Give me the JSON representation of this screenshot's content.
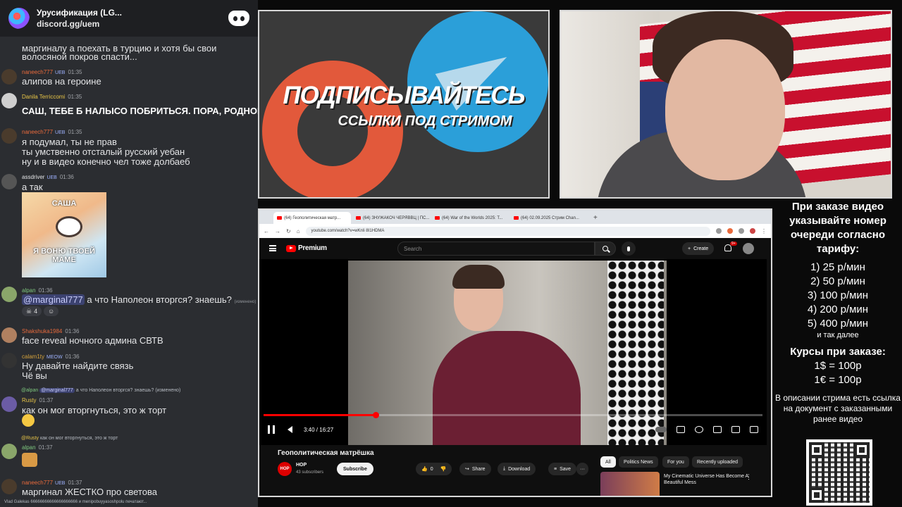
{
  "discord": {
    "server_name": "Урусификация (LG...",
    "invite": "discord.gg/uem",
    "messages": [
      {
        "lines": [
          "маргиналу а поехать в турцию и хотя бы свои",
          "волосяной покров спасти..."
        ]
      },
      {
        "author": "naneech777",
        "author_color": "#e96a3c",
        "badge": "UEB",
        "time": "01:35",
        "lines": [
          "алипов на героине"
        ]
      },
      {
        "author": "Danila Terriccomi",
        "author_color": "#e8c547",
        "time": "01:35",
        "lines": [
          "САШ, ТЕБЕ Б НАЛЫСО ПОБРИТЬСЯ. ПОРА, РОДНОЙ!"
        ]
      },
      {
        "author": "naneech777",
        "author_color": "#e96a3c",
        "badge": "UEB",
        "time": "01:35",
        "lines": [
          "я подумал, ты не прав",
          "ты умственно отсталый русский уебан",
          "ну и в видео конечно чел тоже долбаеб"
        ]
      },
      {
        "author": "assdriver",
        "author_color": "#e3e4e6",
        "badge": "UEB",
        "time": "01:36",
        "lines": [
          "а так"
        ],
        "sticker": {
          "top": "САША",
          "bottom": "Я ВОНЮ ТВОЕЙ МАМЕ"
        }
      },
      {
        "author": "alpan",
        "author_color": "#7fc97f",
        "time": "01:36",
        "mention": "@marginal777",
        "text_after": " а что Наполеон вторгся? знаешь?",
        "edited": "(изменено)",
        "reaction_count": "4"
      },
      {
        "author": "Shakshuka1984",
        "author_color": "#e96a3c",
        "time": "01:36",
        "lines": [
          "face reveal ночного админа СВТВ"
        ]
      },
      {
        "author": "calam1ty",
        "author_color": "#d4a23c",
        "badge": "MEOW",
        "time": "01:36",
        "lines": [
          "Ну давайте найдите связь",
          "Чё вы"
        ]
      },
      {
        "reply_author": "@alpan",
        "reply_mention": "@marginal777",
        "reply_text": " а что Наполеон вторгся? знаешь?",
        "reply_edited": "(изменено)",
        "author": "Rusty",
        "author_color": "#e8c547",
        "time": "01:37",
        "lines": [
          "как он мог вторгнуться, это ж торт"
        ]
      },
      {
        "reply_author": "@Rusty",
        "reply_text": " как он мог вторгнуться, это ж торт",
        "author": "alpan",
        "author_color": "#7fc97f",
        "time": "01:37"
      },
      {
        "author": "naneech777",
        "author_color": "#e96a3c",
        "badge": "UEB",
        "time": "01:37",
        "lines": [
          "маргинал ЖЕСТКО про светова"
        ]
      }
    ],
    "typing": "Vlad Galekas 66666666666666666666 и menipobuyyasoshpolu печатают..."
  },
  "promo": {
    "headline": "ПОДПИСЫВАЙТЕСЬ",
    "subline": "ССЫЛКИ ПОД СТРИМОМ"
  },
  "browser": {
    "tabs": [
      {
        "title": "(64) Геополитическая матр...",
        "active": true
      },
      {
        "title": "(64) ЗНУЖАКОЧ ЧЕРЯВВЦ | ПС...",
        "active": false
      },
      {
        "title": "(64) War of the Worlds 2025: Т...",
        "active": false
      },
      {
        "title": "(64) 02.09.2025 Стрим Chan...",
        "active": false
      }
    ],
    "url": "youtube.com/watch?v=wKnIi 8I1HDMA"
  },
  "youtube": {
    "logo": "Premium",
    "search_placeholder": "Search",
    "create": "Create",
    "notif_count": "9+",
    "time": "3:40 / 16:27",
    "progress": 0.225,
    "video_title": "Геополитическая матрёшка",
    "channel_avatar": "HOP",
    "channel": "HOP",
    "subscribers": "43 subscribers",
    "subscribe": "Subscribe",
    "likes": "0",
    "share": "Share",
    "download": "Download",
    "save": "Save",
    "more": "···",
    "chips": [
      "All",
      "Politics News",
      "For you",
      "Recently uploaded"
    ],
    "rec_title": "My Cinematic Universe Has Become A Beautiful Mess",
    "rec_more": "⋮"
  },
  "pricing": {
    "head": "При заказе видео указывайте номер очереди согласно тарифу:",
    "tariffs": [
      "1) 25 р/мин",
      "2) 50 р/мин",
      "3) 100 р/мин",
      "4) 200 р/мин",
      "5) 400 р/мин"
    ],
    "more": "и так далее",
    "courses_head": "Курсы при заказе:",
    "rates": [
      "1$ = 100р",
      "1€ = 100р"
    ],
    "note": "В описании стрима есть ссылка на документ с заказанными ранее видео"
  }
}
